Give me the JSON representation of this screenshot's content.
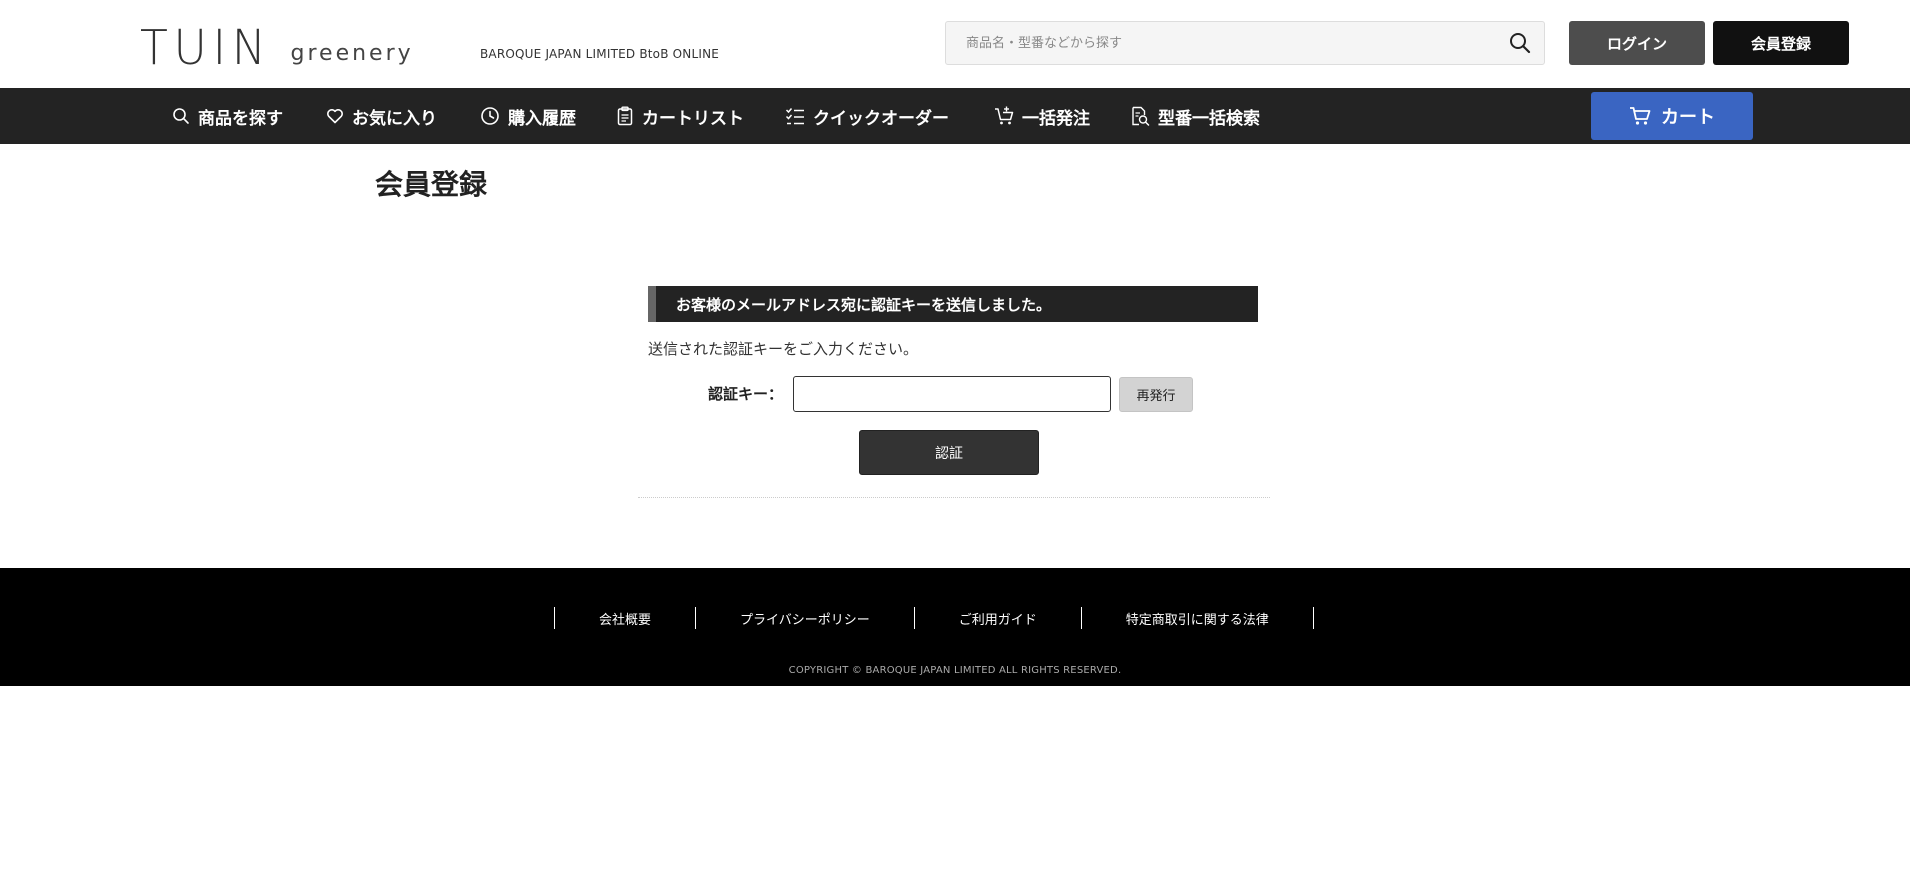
{
  "header": {
    "logo_main": "TUIN",
    "logo_sub": "greenery",
    "tagline": "BAROQUE JAPAN LIMITED BtoB ONLINE",
    "search_placeholder": "商品名・型番などから探す",
    "login_label": "ログイン",
    "register_label": "会員登録"
  },
  "nav": {
    "items": [
      {
        "label": "商品を探す",
        "icon": "search-icon"
      },
      {
        "label": "お気に入り",
        "icon": "heart-icon"
      },
      {
        "label": "購入履歴",
        "icon": "clock-icon"
      },
      {
        "label": "カートリスト",
        "icon": "clipboard-icon"
      },
      {
        "label": "クイックオーダー",
        "icon": "checklist-icon"
      },
      {
        "label": "一括発注",
        "icon": "cart-add-icon"
      },
      {
        "label": "型番一括検索",
        "icon": "document-search-icon"
      }
    ],
    "cart_label": "カート"
  },
  "main": {
    "page_title": "会員登録",
    "notice": "お客様のメールアドレス宛に認証キーを送信しました。",
    "instruction": "送信された認証キーをご入力ください。",
    "key_label": "認証キー：",
    "key_value": "",
    "reissue_label": "再発行",
    "auth_label": "認証"
  },
  "footer": {
    "links": [
      "会社概要",
      "プライバシーポリシー",
      "ご利用ガイド",
      "特定商取引に関する法律"
    ],
    "copyright": "COPYRIGHT © BAROQUE JAPAN LIMITED ALL RIGHTS RESERVED."
  },
  "colors": {
    "nav_bg": "#232323",
    "cart_blue": "#3a65c2",
    "login_gray": "#4d4d4d",
    "register_black": "#111111",
    "footer_bg": "#000000"
  }
}
